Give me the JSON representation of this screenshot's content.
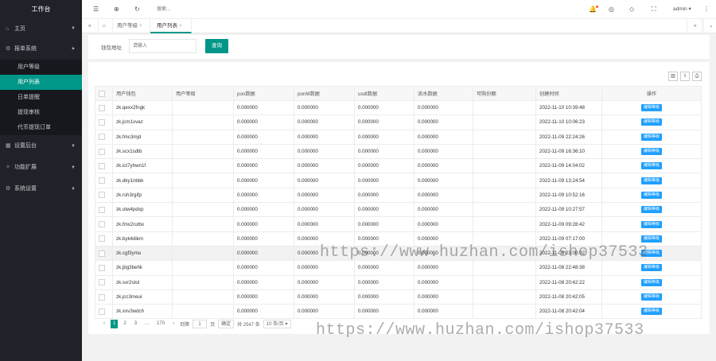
{
  "app": {
    "title": "工作台"
  },
  "sidebar": {
    "items": [
      {
        "label": "主页",
        "icon": "home-icon"
      },
      {
        "label": "报单系统",
        "icon": "gear-icon",
        "expanded": true,
        "children": [
          {
            "label": "用户等级",
            "active": false
          },
          {
            "label": "用户列表",
            "active": true
          },
          {
            "label": "日单提醒",
            "active": false
          },
          {
            "label": "提现审核",
            "active": false
          },
          {
            "label": "代币提现订单",
            "active": false
          }
        ]
      },
      {
        "label": "设置后台",
        "icon": "grid-icon"
      },
      {
        "label": "功能扩展",
        "icon": "star-icon"
      },
      {
        "label": "系统设置",
        "icon": "settings-icon"
      }
    ]
  },
  "topbar": {
    "search_placeholder": "搜索...",
    "user": "admin"
  },
  "tabs": [
    {
      "label": "用户等级",
      "active": false
    },
    {
      "label": "用户列表",
      "active": true
    }
  ],
  "search": {
    "label": "钱包地址",
    "placeholder": "请输入",
    "button": "查询"
  },
  "table": {
    "headers": [
      "用户钱包",
      "用户等级",
      "pon数据",
      "ponM数据",
      "usdt数据",
      "流水数据",
      "可购份额",
      "创建时间",
      "操作"
    ],
    "rows": [
      {
        "wallet": "zk.qexx2fngk",
        "level": "",
        "pon": "0.000000",
        "ponm": "0.000000",
        "usdt": "0.000000",
        "flow": "0.000000",
        "share": "",
        "time": "2022-11-10 10:39:48",
        "action": "编辑等级"
      },
      {
        "wallet": "zk.jcm1vvaz",
        "level": "",
        "pon": "0.000000",
        "ponm": "0.000000",
        "usdt": "0.000000",
        "flow": "0.000000",
        "share": "",
        "time": "2022-11-10 10:06:23",
        "action": "编辑等级"
      },
      {
        "wallet": "zk.fmc3mjd",
        "level": "",
        "pon": "0.000000",
        "ponm": "0.000000",
        "usdt": "0.000000",
        "flow": "0.000000",
        "share": "",
        "time": "2022-11-09 22:24:26",
        "action": "编辑等级"
      },
      {
        "wallet": "zk.scx1sdtb",
        "level": "",
        "pon": "0.000000",
        "ponm": "0.000000",
        "usdt": "0.000000",
        "flow": "0.000000",
        "share": "",
        "time": "2022-11-09 16:36:10",
        "action": "编辑等级"
      },
      {
        "wallet": "zk.ict7yhwn1f",
        "level": "",
        "pon": "0.000000",
        "ponm": "0.000000",
        "usdt": "0.000000",
        "flow": "0.000000",
        "share": "",
        "time": "2022-11-09 14:04:02",
        "action": "编辑等级"
      },
      {
        "wallet": "zk.dky1nbbk",
        "level": "",
        "pon": "0.000000",
        "ponm": "0.000000",
        "usdt": "0.000000",
        "flow": "0.000000",
        "share": "",
        "time": "2022-11-09 13:24:54",
        "action": "编辑等级"
      },
      {
        "wallet": "zk.rsh3rgifp",
        "level": "",
        "pon": "0.000000",
        "ponm": "0.000000",
        "usdt": "0.000000",
        "flow": "0.000000",
        "share": "",
        "time": "2022-11-09 10:52:16",
        "action": "编辑等级"
      },
      {
        "wallet": "zk.otw4pdxp",
        "level": "",
        "pon": "0.000000",
        "ponm": "0.000000",
        "usdt": "0.000000",
        "flow": "0.000000",
        "share": "",
        "time": "2022-11-09 10:27:57",
        "action": "编辑等级"
      },
      {
        "wallet": "zk.fmx2rutbx",
        "level": "",
        "pon": "0.000000",
        "ponm": "0.000000",
        "usdt": "0.000000",
        "flow": "0.000000",
        "share": "",
        "time": "2022-11-09 09:28:42",
        "action": "编辑等级"
      },
      {
        "wallet": "zk.byk4dikm",
        "level": "",
        "pon": "0.000000",
        "ponm": "0.000000",
        "usdt": "0.000000",
        "flow": "0.000000",
        "share": "",
        "time": "2022-11-09 07:17:00",
        "action": "编辑等级"
      },
      {
        "wallet": "zk.cgf3ymu",
        "level": "",
        "pon": "0.000000",
        "ponm": "0.000000",
        "usdt": "0.000000",
        "flow": "0.000000",
        "share": "",
        "time": "2022-11-08 23:00:02",
        "action": "编辑等级"
      },
      {
        "wallet": "zk.jbg3behk",
        "level": "",
        "pon": "0.000000",
        "ponm": "0.000000",
        "usdt": "0.000000",
        "flow": "0.000000",
        "share": "",
        "time": "2022-11-08 22:48:38",
        "action": "编辑等级"
      },
      {
        "wallet": "zk.svr2stol",
        "level": "",
        "pon": "0.000000",
        "ponm": "0.000000",
        "usdt": "0.000000",
        "flow": "0.000000",
        "share": "",
        "time": "2022-11-08 20:42:22",
        "action": "编辑等级"
      },
      {
        "wallet": "zk.jcc3meui",
        "level": "",
        "pon": "0.000000",
        "ponm": "0.000000",
        "usdt": "0.000000",
        "flow": "0.000000",
        "share": "",
        "time": "2022-11-08 20:42:05",
        "action": "编辑等级"
      },
      {
        "wallet": "zk.xxv3wdch",
        "level": "",
        "pon": "0.000000",
        "ponm": "0.000000",
        "usdt": "0.000000",
        "flow": "0.000000",
        "share": "",
        "time": "2022-11-08 20:42:04",
        "action": "编辑等级"
      }
    ]
  },
  "pager": {
    "pages": [
      "1",
      "2",
      "3"
    ],
    "ellipsis": "...",
    "last": "170",
    "goto_label": "到第",
    "goto_value": "1",
    "page_unit": "页",
    "confirm": "确定",
    "total": "共 2547 条",
    "per_page": "10 条/页"
  },
  "watermark": "https://www.huzhan.com/ishop37533",
  "colors": {
    "sidebar_bg": "#20222a",
    "accent": "#009688",
    "action_btn": "#1e9fff"
  }
}
